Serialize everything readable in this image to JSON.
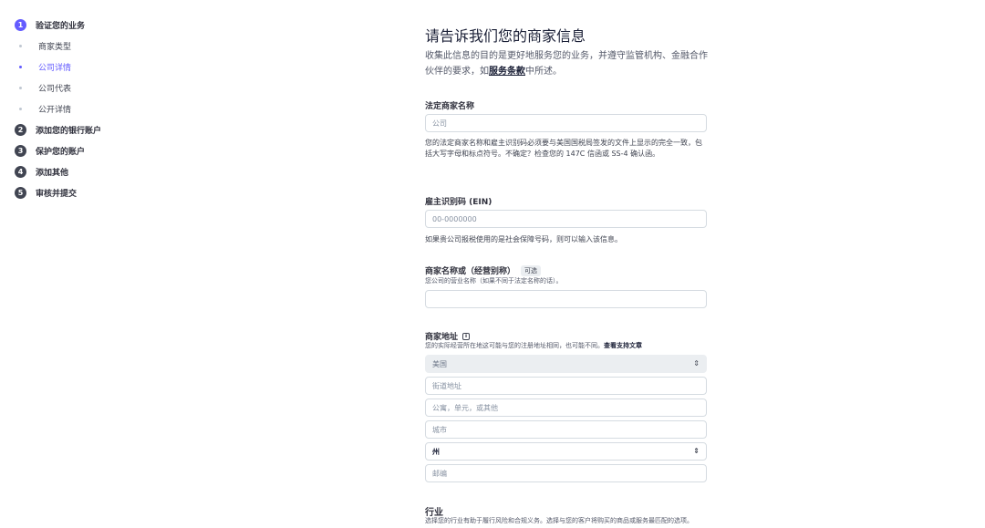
{
  "sidebar": {
    "steps": [
      {
        "num": "1",
        "label": "验证您的业务",
        "active": true
      },
      {
        "num": "2",
        "label": "添加您的银行账户"
      },
      {
        "num": "3",
        "label": "保护您的账户"
      },
      {
        "num": "4",
        "label": "添加其他"
      },
      {
        "num": "5",
        "label": "审核并提交"
      }
    ],
    "substeps": [
      {
        "label": "商家类型"
      },
      {
        "label": "公司详情",
        "active": true
      },
      {
        "label": "公司代表"
      },
      {
        "label": "公开详情"
      }
    ]
  },
  "form": {
    "title": "请告诉我们您的商家信息",
    "desc_before": "收集此信息的目的是更好地服务您的业务，并遵守监管机构、金融合作伙伴的要求，如",
    "desc_link": "服务条款",
    "desc_after": "中所述。",
    "legal_name": {
      "label": "法定商家名称",
      "placeholder": "公司",
      "help": "您的法定商家名称和雇主识别码必须要与美国国税局签发的文件上显示的完全一致，包括大写字母和标点符号。不确定？检查您的 147C 信函或 SS-4 确认函。"
    },
    "ein": {
      "label": "雇主识别码 (EIN)",
      "placeholder": "00-0000000",
      "help": "如果贵公司报税使用的是社会保障号码，则可以输入该信息。"
    },
    "dba": {
      "label": "商家名称或（经营别称）",
      "badge": "可选",
      "sub": "您公司的营业名称（如果不同于法定名称的话）。",
      "value": ""
    },
    "address": {
      "label": "商家地址",
      "sub_before": "您的实际经营所在地这可能与您的注册地址相同，也可能不同。",
      "sub_link": "查看支持文章",
      "country": "美国",
      "street_placeholder": "街道地址",
      "apt_placeholder": "公寓，单元，或其他",
      "city_placeholder": "城市",
      "state": "州",
      "zip_placeholder": "邮编"
    },
    "industry": {
      "label": "行业",
      "sub": "选择您的行业有助于履行风险和合规义务。选择与您的客户将购买的商品或服务最匹配的选项。"
    }
  }
}
